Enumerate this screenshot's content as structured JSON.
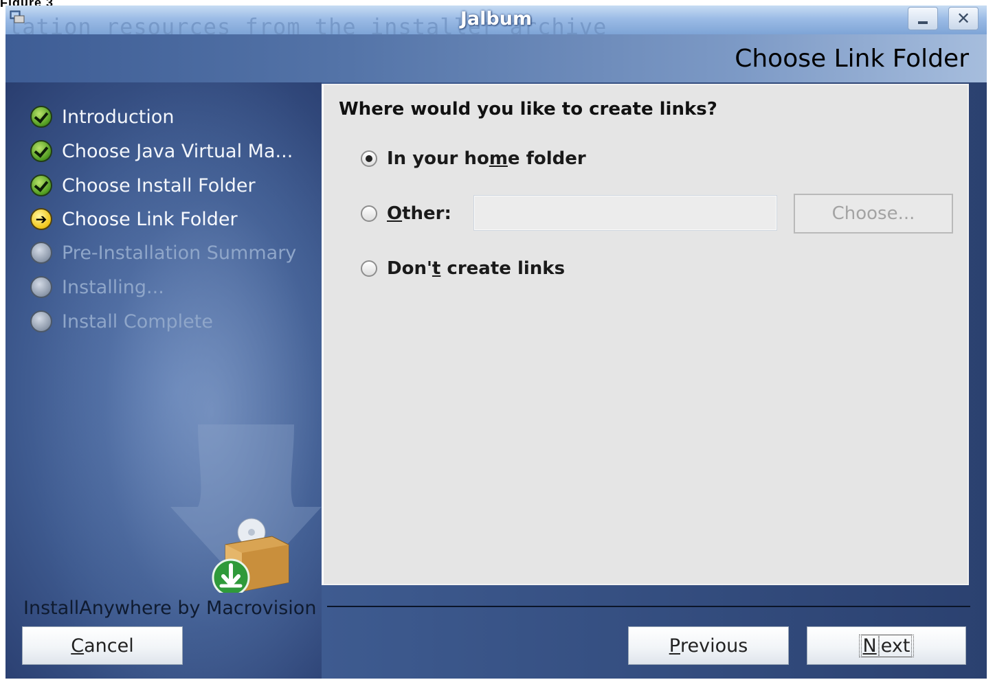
{
  "corner_label": "Figure 3",
  "window": {
    "title": "Jalbum",
    "background_title": "lation resources from the installer archive",
    "minimize_label": "_",
    "close_label": "✕"
  },
  "panel_title": "Choose Link Folder",
  "steps": [
    {
      "label": "Introduction",
      "state": "done"
    },
    {
      "label": "Choose Java Virtual Ma...",
      "state": "done"
    },
    {
      "label": "Choose Install Folder",
      "state": "done"
    },
    {
      "label": "Choose Link Folder",
      "state": "current"
    },
    {
      "label": "Pre-Installation Summary",
      "state": "pending"
    },
    {
      "label": "Installing...",
      "state": "pending"
    },
    {
      "label": "Install Complete",
      "state": "pending"
    }
  ],
  "brand": "InstallAnywhere by Macrovision",
  "content": {
    "question": "Where would you like to create links?",
    "options": {
      "home": {
        "pre": "In your ho",
        "underlined": "m",
        "post": "e folder",
        "selected": true
      },
      "other": {
        "pre": "",
        "underlined": "O",
        "post": "ther:",
        "selected": false,
        "value": ""
      },
      "none": {
        "pre": "Don'",
        "underlined": "t",
        "post": " create links",
        "selected": false
      }
    },
    "choose_button": "Choose..."
  },
  "buttons": {
    "cancel": {
      "underlined": "C",
      "rest": "ancel"
    },
    "previous": {
      "underlined": "P",
      "rest": "revious"
    },
    "next": {
      "underlined": "N",
      "rest": "ext"
    }
  }
}
